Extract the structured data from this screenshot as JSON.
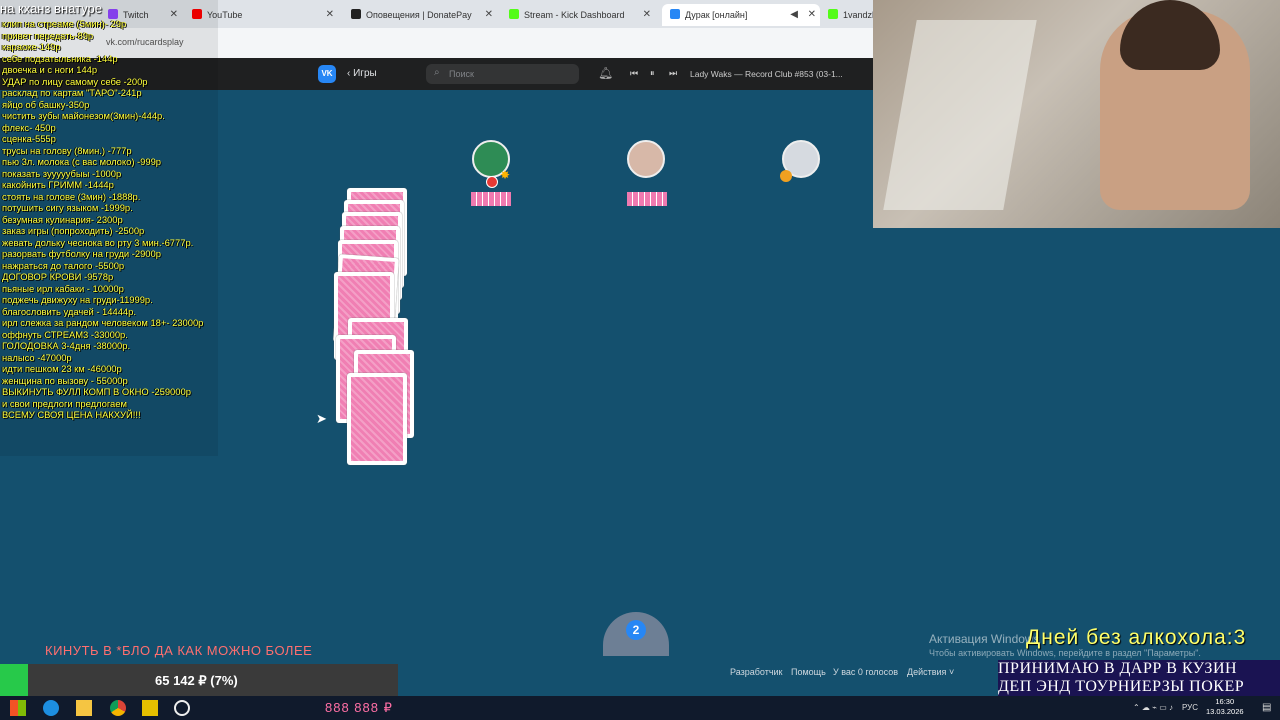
{
  "browser": {
    "tabs": [
      {
        "label": "Twitch",
        "icon": "twitch-icon",
        "color": "#9146ff"
      },
      {
        "label": "YouTube",
        "icon": "youtube-icon",
        "color": "#ff0000"
      },
      {
        "label": "Оповещения | DonatePay",
        "icon": "donatepay-icon",
        "color": "#222222"
      },
      {
        "label": "Stream - Kick Dashboard",
        "icon": "kick-icon",
        "color": "#53fc18"
      },
      {
        "label": "Дурак [онлайн]",
        "icon": "vk-icon",
        "color": "#2787f5",
        "active": true
      },
      {
        "label": "1vandzh",
        "icon": "kick-icon",
        "color": "#53fc18"
      }
    ],
    "url": "vk.com/rucardsplay"
  },
  "vk": {
    "logo": "VK",
    "back_label": "Игры",
    "search_placeholder": "Поиск",
    "track": "Lady Waks — Record Club #853 (03-1..."
  },
  "overlay": {
    "title": "на кханз внатуре",
    "price_list": [
      "клип на стреаме (5мин)- 29р",
      "привет передать-89р",
      "караоке-149р",
      "себе подзатыльника -144р",
      "двоечка и с ноги 144р",
      "УДАР по лицу самому себе -200р",
      "расклад по картам \"ТАРО\"-241р",
      "яйцо об башку-350р",
      "чистить зубы майонезом(3мин)-444р.",
      "флекс- 450р",
      "сценка-555р",
      "трусы на голову (8мин.) -777р",
      "пью 3л. молока (с вас молоко) -999р",
      "показать зууууубыы -1000р",
      "какойнить ГРИММ -1444р",
      "стоять на голове (3мин) -1888р.",
      "потушить сигу языком -1999р.",
      "безумная кулинария- 2300р",
      "заказ игры (попроходить) -2500р",
      "жевать дольку чеснока во рту 3 мин.-6777р.",
      "разорвать футболку на груди -2900р",
      "нажраться до талого -5500р",
      "ДОГОВОР КРОВИ -9578р",
      "пьяные ирл кабаки - 10000р",
      "поджечь движуху на груди-11999р.",
      "благословить удачей - 14444р.",
      "ирл слежка за рандом человеком 18+- 23000р",
      "оффнуть СТРЕАМ3 -33000р.",
      "ГОЛОДОВКА 3-4дня -38000р.",
      "налысо -47000р",
      "идти пешком 23 км -46000р",
      "женщина по вызову - 55000р",
      "ВЫКИНУТЬ ФУЛЛ КОМП В ОКНО -259000р",
      "и свои предлоги предлогаем",
      "ВСЕМУ СВОЯ ЦЕНА НАКХУЙ!!!"
    ],
    "ticker": "КИНУТЬ В *БЛО ДА КАК МОЖНО БОЛЕЕ",
    "goal": {
      "text": "65 142 ₽ (7%)",
      "progress_percent": 7
    },
    "counter": "888 888 ₽",
    "days_label": "Дней без алкохола:3",
    "promo_line1": "ПРИНИМАЮ В ДАРР В КУЗИН",
    "promo_line2": "ДЕП ЭНД ТОУРНИЕРЗЫ ПОКЕР"
  },
  "game": {
    "player_badge": "2"
  },
  "windows": {
    "activation_title": "Активация Windows",
    "activation_sub": "Чтобы активировать Windows, перейдите в раздел \"Параметры\".",
    "lang": "РУС",
    "time": "16:30",
    "date": "13.03.2026"
  },
  "footer": {
    "dev": "Разработчик",
    "help": "Помощь",
    "votes": "У вас 0 голосов",
    "actions": "Действия"
  }
}
